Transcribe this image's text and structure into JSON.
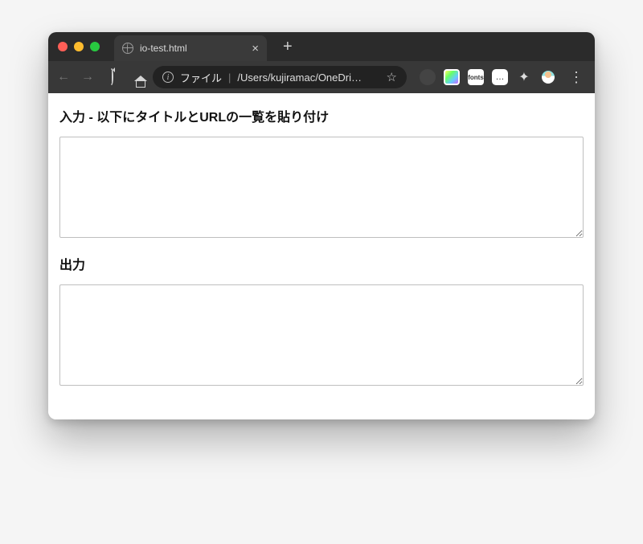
{
  "browser": {
    "tab": {
      "title": "io-test.html",
      "close_glyph": "×"
    },
    "newtab_glyph": "+",
    "nav": {
      "back_glyph": "←",
      "forward_glyph": "→"
    },
    "address": {
      "info_glyph": "i",
      "prefix": "ファイル",
      "separator": "|",
      "path": "/Users/kujiramac/OneDri…",
      "star_glyph": "☆"
    },
    "ext": {
      "fonts_label": "fonts",
      "speech_glyph": "…",
      "puzzle_glyph": "✦"
    },
    "menu_glyph": "⋮"
  },
  "page": {
    "input_heading": "入力 - 以下にタイトルとURLの一覧を貼り付け",
    "input_value": "",
    "output_heading": "出力",
    "output_value": ""
  }
}
